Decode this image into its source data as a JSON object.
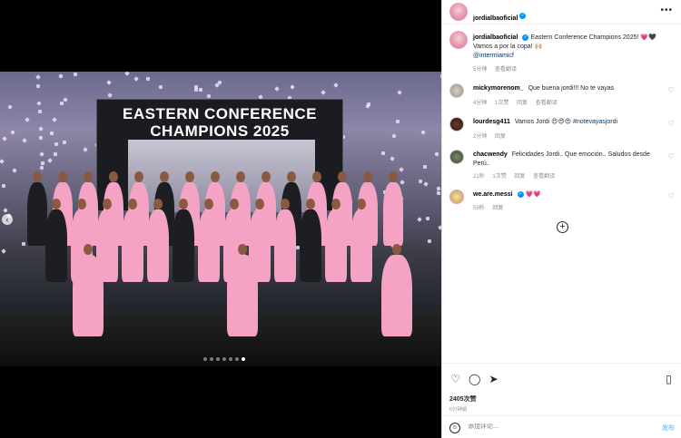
{
  "post": {
    "author": "jordialbaoficial",
    "more_icon": "more-horizontal-icon"
  },
  "photo": {
    "banner_title": "EASTERN CONFERENCE\nCHAMPIONS 2025",
    "slides": 7,
    "current_slide": 7
  },
  "caption": {
    "user": "jordialbaoficial",
    "text": "Eastern Conference Champions 2025! 💗🖤 Vamos a por la copa! 🙌🏼",
    "mention": "@intermiamicf",
    "time": "5分钟",
    "translate": "查看翻译"
  },
  "comments": [
    {
      "user": "mickymorenom_",
      "text": "Que buena jordi!!! No te vayas",
      "time": "4分钟",
      "likes": "1次赞",
      "reply": "回复",
      "translate": "查看翻译"
    },
    {
      "user": "lourdesg411",
      "text": "Vamos Jordi 😍😍😍",
      "tag": "#notevayasjordi",
      "time": "2分钟",
      "reply": "回复"
    },
    {
      "user": "chacwendy",
      "text": "Felicidades Jordi.. Que emoción.. Saludos desde Perú..",
      "time": "21秒",
      "likes": "1次赞",
      "reply": "回复",
      "translate": "查看翻译"
    },
    {
      "user": "we.are.messi",
      "text": "💗💗",
      "time": "59秒",
      "reply": "回复"
    }
  ],
  "stats": {
    "likes": "2405次赞",
    "ago": "5分钟前"
  },
  "composer": {
    "placeholder": "添加评论...",
    "post_label": "发布"
  },
  "colors": {
    "verified": "#0095f6",
    "jersey_pink": "#f4a3c4",
    "link": "#00376b"
  }
}
